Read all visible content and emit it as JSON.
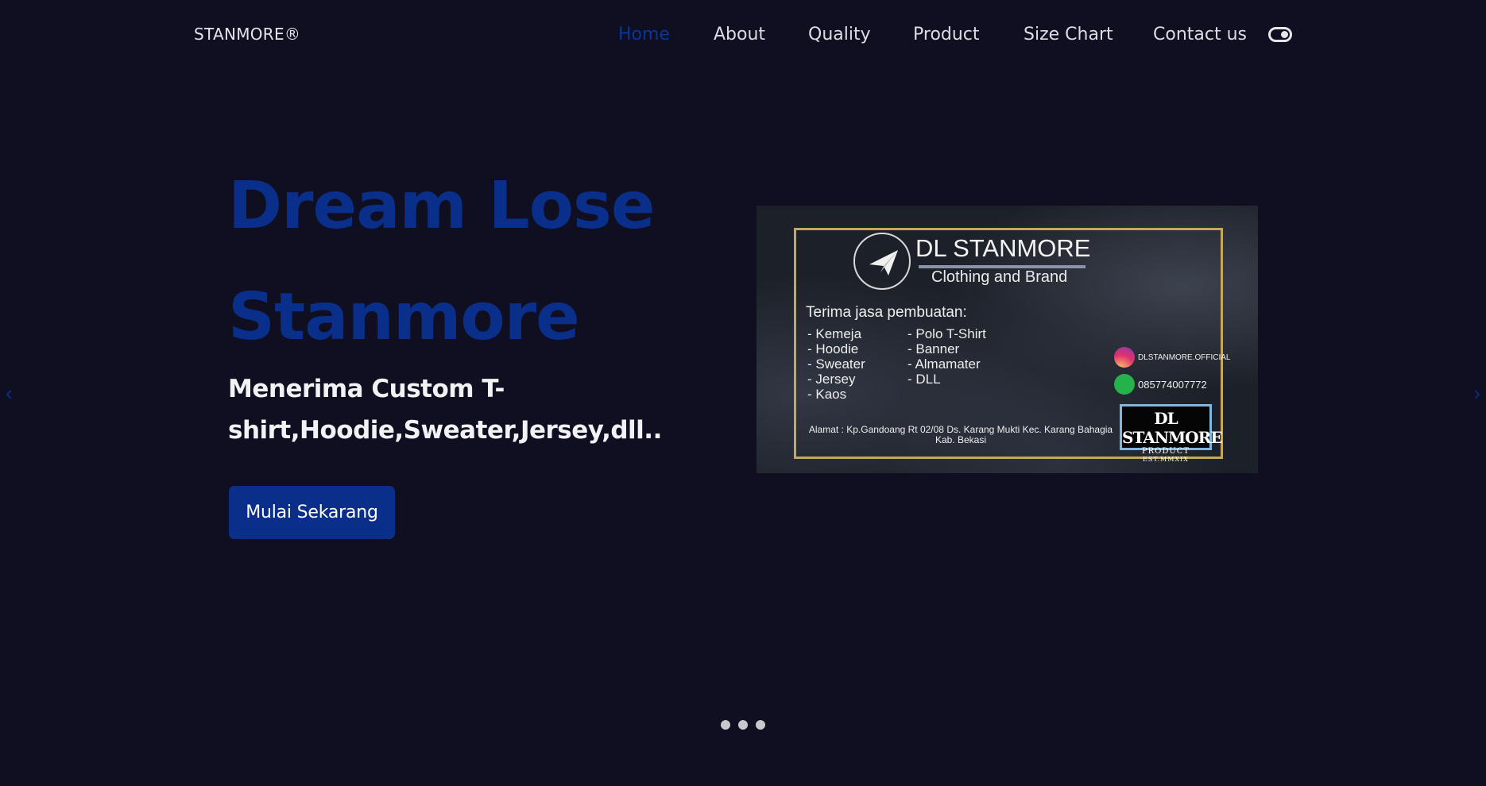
{
  "brand": "STANMORE®",
  "nav": {
    "items": [
      {
        "label": "Home",
        "active": true
      },
      {
        "label": "About",
        "active": false
      },
      {
        "label": "Quality",
        "active": false
      },
      {
        "label": "Product",
        "active": false
      },
      {
        "label": "Size Chart",
        "active": false
      },
      {
        "label": "Contact us",
        "active": false
      }
    ],
    "theme_toggle_icon": "toggle-icon"
  },
  "hero": {
    "title_line1": "Dream Lose",
    "title_line2": "Stanmore",
    "subtitle": "Menerima Custom T-shirt,Hoodie,Sweater,Jersey,dll..",
    "cta_label": "Mulai Sekarang"
  },
  "banner": {
    "title": "DL STANMORE",
    "subtitle": "Clothing and Brand",
    "services_title": "Terima jasa pembuatan:",
    "services_col1": [
      "- Kemeja",
      "- Hoodie",
      "- Sweater",
      "- Jersey",
      "- Kaos"
    ],
    "services_col2": [
      "- Polo T-Shirt",
      "- Banner",
      "- Almamater",
      "- DLL"
    ],
    "instagram": "DLSTANMORE.OFFICIAL",
    "whatsapp": "085774007772",
    "badge_line1": "DL STANMORE",
    "badge_line2": "PRODUCT",
    "badge_line3": "EST.MMXIX",
    "address": "Alamat : Kp.Gandoang Rt 02/08 Ds. Karang Mukti Kec. Karang Bahagia Kab. Bekasi"
  },
  "carousel": {
    "prev_icon": "‹",
    "next_icon": "›",
    "dots": 3
  },
  "colors": {
    "background": "#0f0f21",
    "accent": "#0a2f8a",
    "text": "#e8e8ee"
  }
}
